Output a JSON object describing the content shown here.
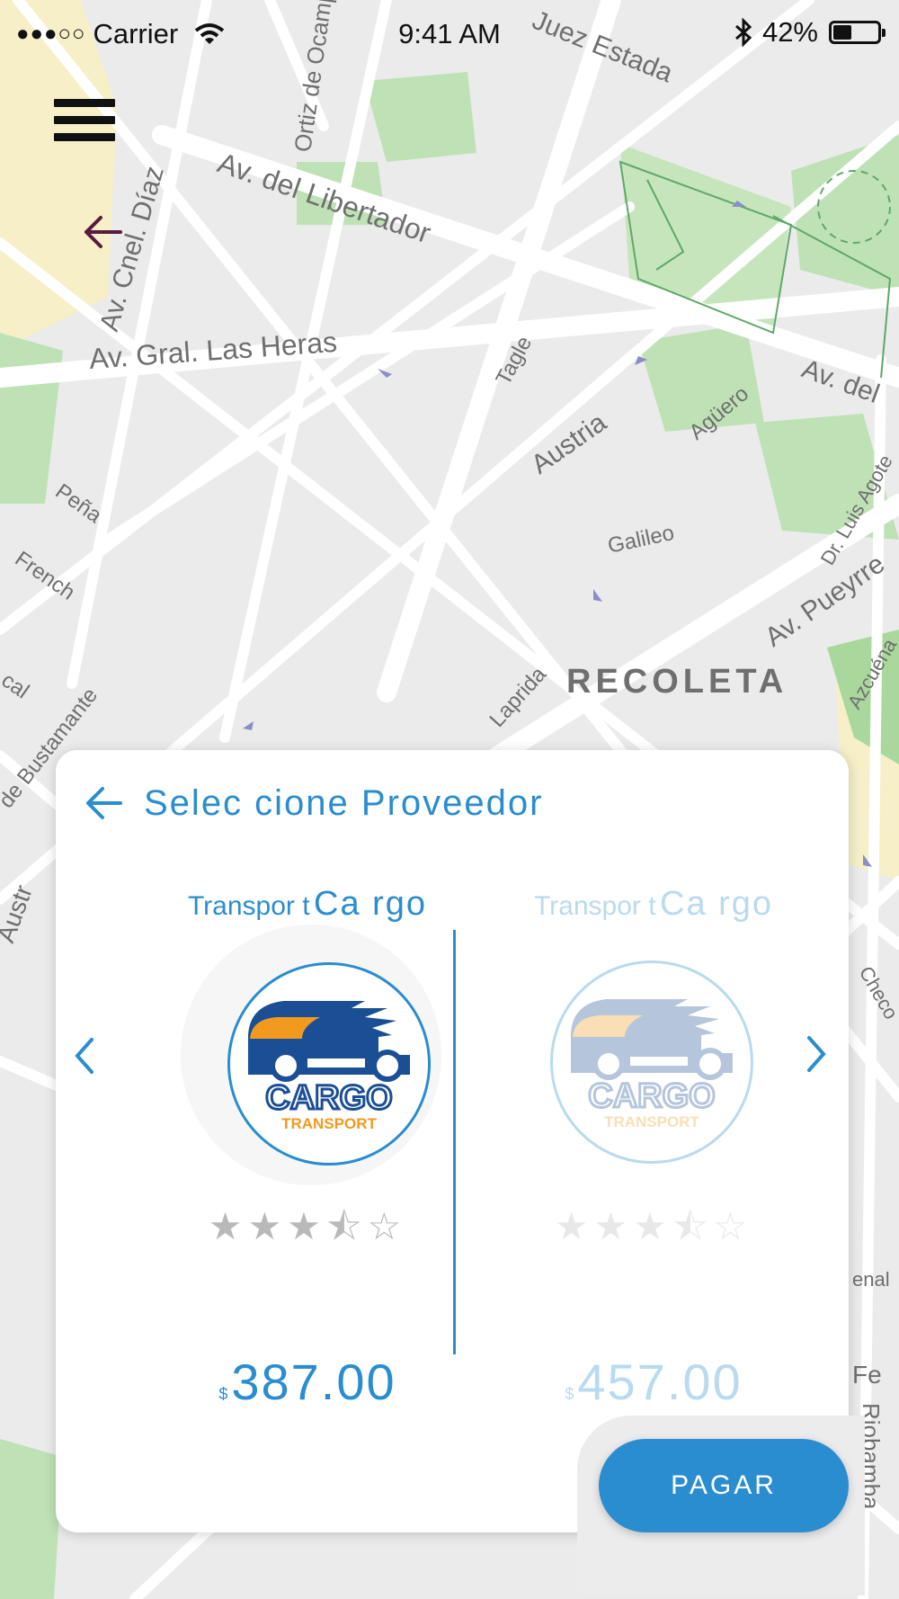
{
  "status_bar": {
    "signal": "●●●○○",
    "carrier": "Carrier",
    "time": "9:41 AM",
    "battery_percent": "42%",
    "battery_level": 0.42
  },
  "map": {
    "streets": [
      "Juez Estada",
      "Ortiz de Ocampo",
      "Av. del Libertador",
      "Av. Cnel. Díaz",
      "Av. Gral. Las Heras",
      "Tagle",
      "Austria",
      "Agüero",
      "Av. del",
      "Galileo",
      "Peña",
      "French",
      "Dr. Luis Agote",
      "Av. Pueyrre",
      "Laprida",
      "de Bustamante",
      "Azcuéna",
      "Checo",
      "Riobamba",
      "Fe",
      "enal",
      "Austr",
      "cal"
    ],
    "district": "RECOLETA"
  },
  "panel": {
    "title": "Selec cione Proveedor",
    "providers": [
      {
        "name_part1": "Transpor t",
        "name_part2": "Ca rgo",
        "logo_text": "CARGO",
        "logo_subtext": "TRANSPORT",
        "rating": 3.5,
        "currency": "$",
        "price": "387.00"
      },
      {
        "name_part1": "Transpor t",
        "name_part2": "Ca rgo",
        "logo_text": "CARGO",
        "logo_subtext": "TRANSPORT",
        "rating": 3.5,
        "currency": "$",
        "price": "457.00"
      }
    ]
  },
  "pay_button": {
    "label": "PAGAR"
  },
  "colors": {
    "accent": "#2a8dd0",
    "logo_navy": "#1b4f95",
    "logo_orange": "#f29a1e",
    "map_green": "#b9dfb0",
    "map_back_arrow": "#5a1a40"
  }
}
